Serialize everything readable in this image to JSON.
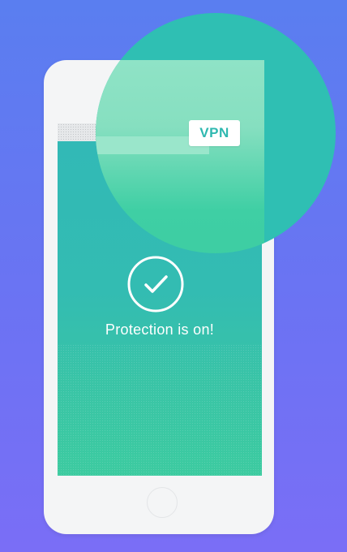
{
  "vpn_badge": {
    "label": "VPN"
  },
  "main": {
    "status_text": "Protection is on!",
    "status_icon": "check-circle-icon"
  },
  "colors": {
    "background_top": "#5a7ef0",
    "background_bottom": "#7a6ef6",
    "phone_body": "#f4f5f6",
    "screen_teal": "#32b9b6",
    "screen_green": "#3ccba0",
    "circle_teal": "#2fbfb3",
    "circle_mint": "#8fe3c6",
    "badge_text": "#2fb8b0"
  }
}
